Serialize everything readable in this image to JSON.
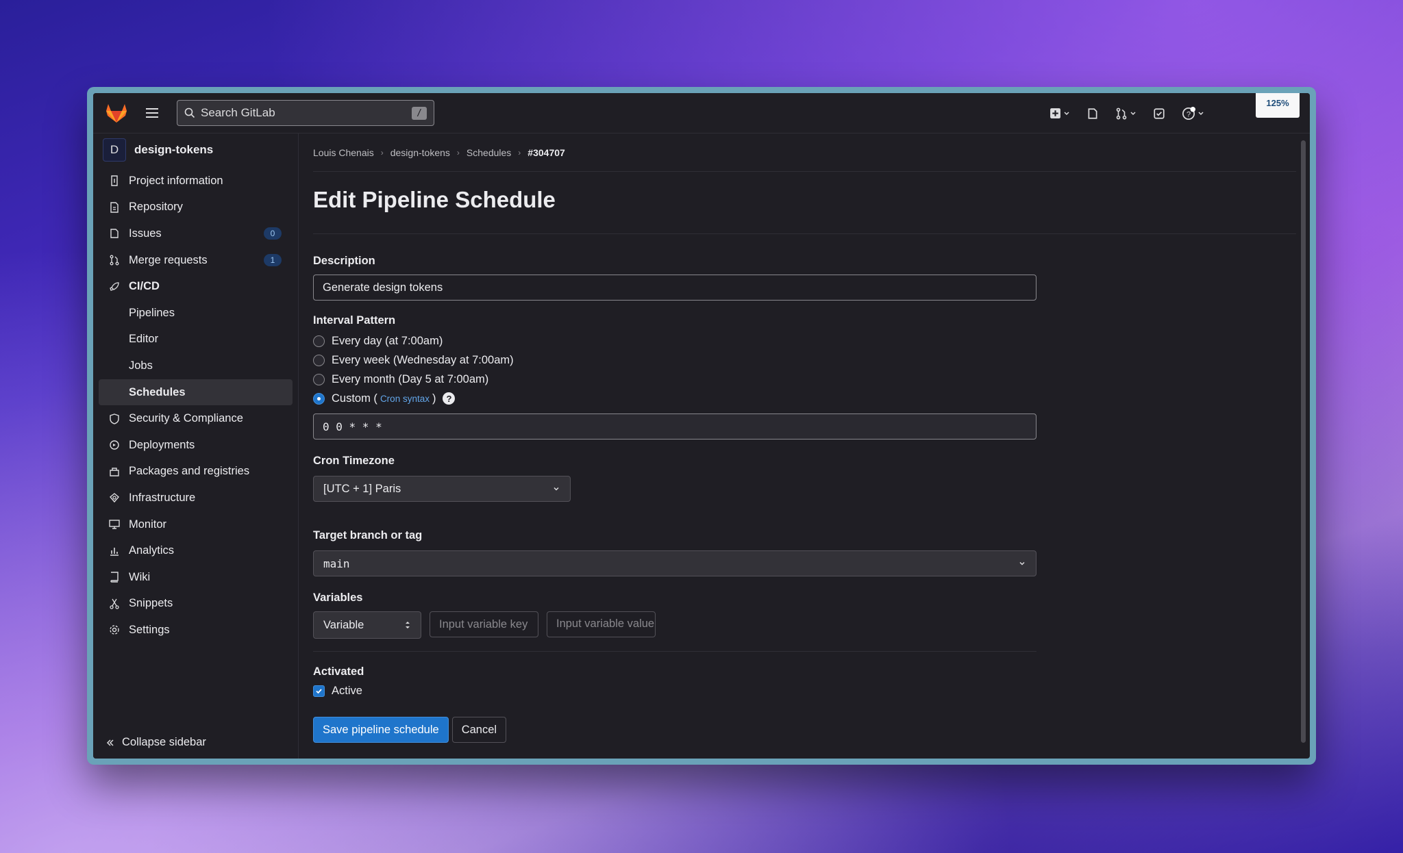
{
  "topbar": {
    "search_placeholder": "Search GitLab",
    "search_shortcut": "/",
    "zoom_level": "125%"
  },
  "sidebar": {
    "project_initial": "D",
    "project_name": "design-tokens",
    "items": [
      {
        "label": "Project information",
        "icon": "info-icon"
      },
      {
        "label": "Repository",
        "icon": "doc-icon"
      },
      {
        "label": "Issues",
        "icon": "issues-icon",
        "badge": "0"
      },
      {
        "label": "Merge requests",
        "icon": "merge-request-icon",
        "badge": "1"
      },
      {
        "label": "CI/CD",
        "icon": "rocket-icon"
      },
      {
        "label": "Pipelines"
      },
      {
        "label": "Editor"
      },
      {
        "label": "Jobs"
      },
      {
        "label": "Schedules"
      },
      {
        "label": "Security & Compliance",
        "icon": "shield-icon"
      },
      {
        "label": "Deployments",
        "icon": "deployments-icon"
      },
      {
        "label": "Packages and registries",
        "icon": "package-icon"
      },
      {
        "label": "Infrastructure",
        "icon": "cloud-icon"
      },
      {
        "label": "Monitor",
        "icon": "monitor-icon"
      },
      {
        "label": "Analytics",
        "icon": "chart-icon"
      },
      {
        "label": "Wiki",
        "icon": "book-icon"
      },
      {
        "label": "Snippets",
        "icon": "scissors-icon"
      },
      {
        "label": "Settings",
        "icon": "gear-icon"
      }
    ],
    "collapse_label": "Collapse sidebar"
  },
  "breadcrumb": [
    "Louis Chenais",
    "design-tokens",
    "Schedules",
    "#304707"
  ],
  "page": {
    "title": "Edit Pipeline Schedule",
    "description_label": "Description",
    "description_value": "Generate design tokens",
    "interval_label": "Interval Pattern",
    "interval_options": [
      "Every day (at 7:00am)",
      "Every week (Wednesday at 7:00am)",
      "Every month (Day 5 at 7:00am)"
    ],
    "custom_label_prefix": "Custom (",
    "custom_link": "Cron syntax",
    "custom_label_suffix": ")",
    "cron_value": "0 0 * * *",
    "timezone_label": "Cron Timezone",
    "timezone_value": "[UTC + 1] Paris",
    "branch_label": "Target branch or tag",
    "branch_value": "main",
    "variables_label": "Variables",
    "variable_type": "Variable",
    "variable_key_placeholder": "Input variable key",
    "variable_value_placeholder": "Input variable value",
    "activated_label": "Activated",
    "active_label": "Active",
    "save_label": "Save pipeline schedule",
    "cancel_label": "Cancel"
  },
  "colors": {
    "primary": "#1f75cb",
    "background": "#1f1e24",
    "logo_orange": "#fc6d26"
  }
}
